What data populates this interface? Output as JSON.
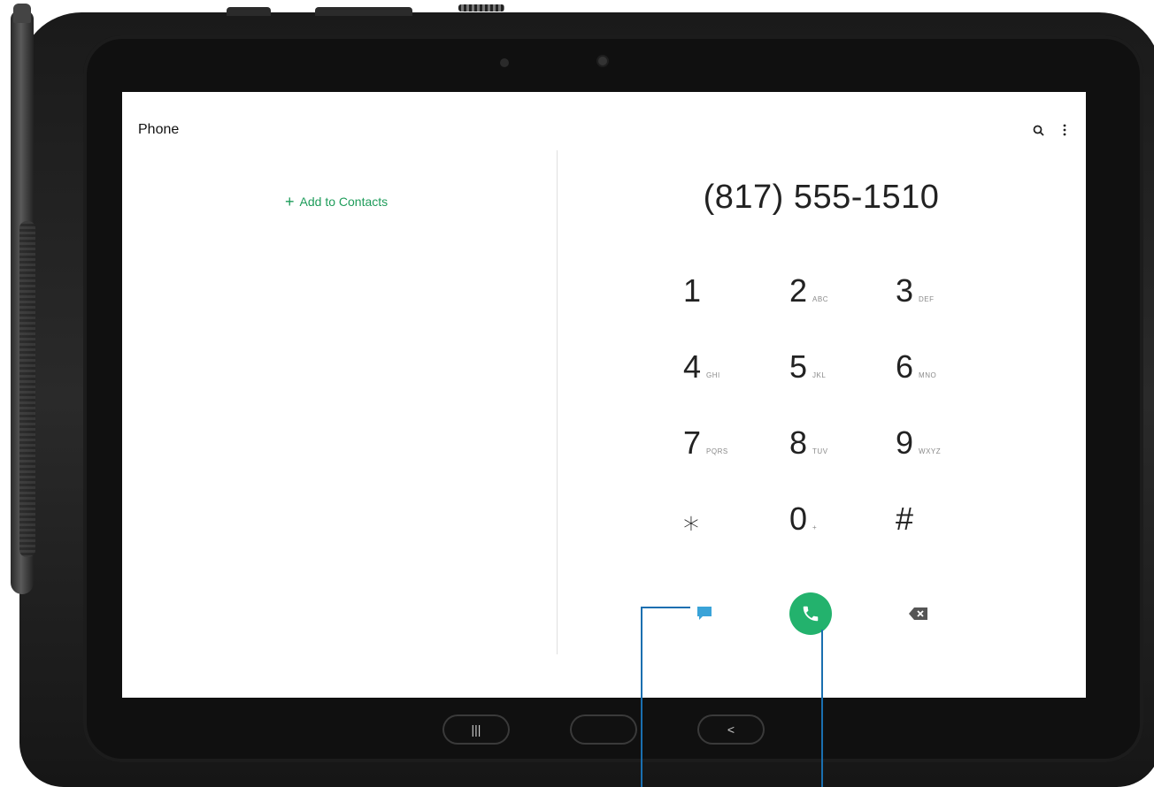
{
  "app": {
    "title": "Phone"
  },
  "toolbar": {
    "search_icon": "search-icon",
    "more_icon": "more-vert-icon"
  },
  "contacts": {
    "add_label": "Add to Contacts",
    "add_icon": "plus-icon"
  },
  "dialer": {
    "number": "(817) 555-1510",
    "keys": [
      {
        "digit": "1",
        "letters": ""
      },
      {
        "digit": "2",
        "letters": "ABC"
      },
      {
        "digit": "3",
        "letters": "DEF"
      },
      {
        "digit": "4",
        "letters": "GHI"
      },
      {
        "digit": "5",
        "letters": "JKL"
      },
      {
        "digit": "6",
        "letters": "MNO"
      },
      {
        "digit": "7",
        "letters": "PQRS"
      },
      {
        "digit": "8",
        "letters": "TUV"
      },
      {
        "digit": "9",
        "letters": "WXYZ"
      },
      {
        "digit": "⁎",
        "letters": ""
      },
      {
        "digit": "0",
        "letters": "+"
      },
      {
        "digit": "#",
        "letters": ""
      }
    ],
    "actions": {
      "message_icon": "message-icon",
      "call_icon": "phone-call-icon",
      "backspace_icon": "backspace-icon"
    }
  },
  "navbar": {
    "recents_label": "|||",
    "home_label": "",
    "back_label": "<"
  },
  "colors": {
    "accent_green": "#23b26d",
    "link_green": "#1e9c5a",
    "message_blue": "#3aa3d8",
    "callout_line": "#1a6fb0"
  }
}
